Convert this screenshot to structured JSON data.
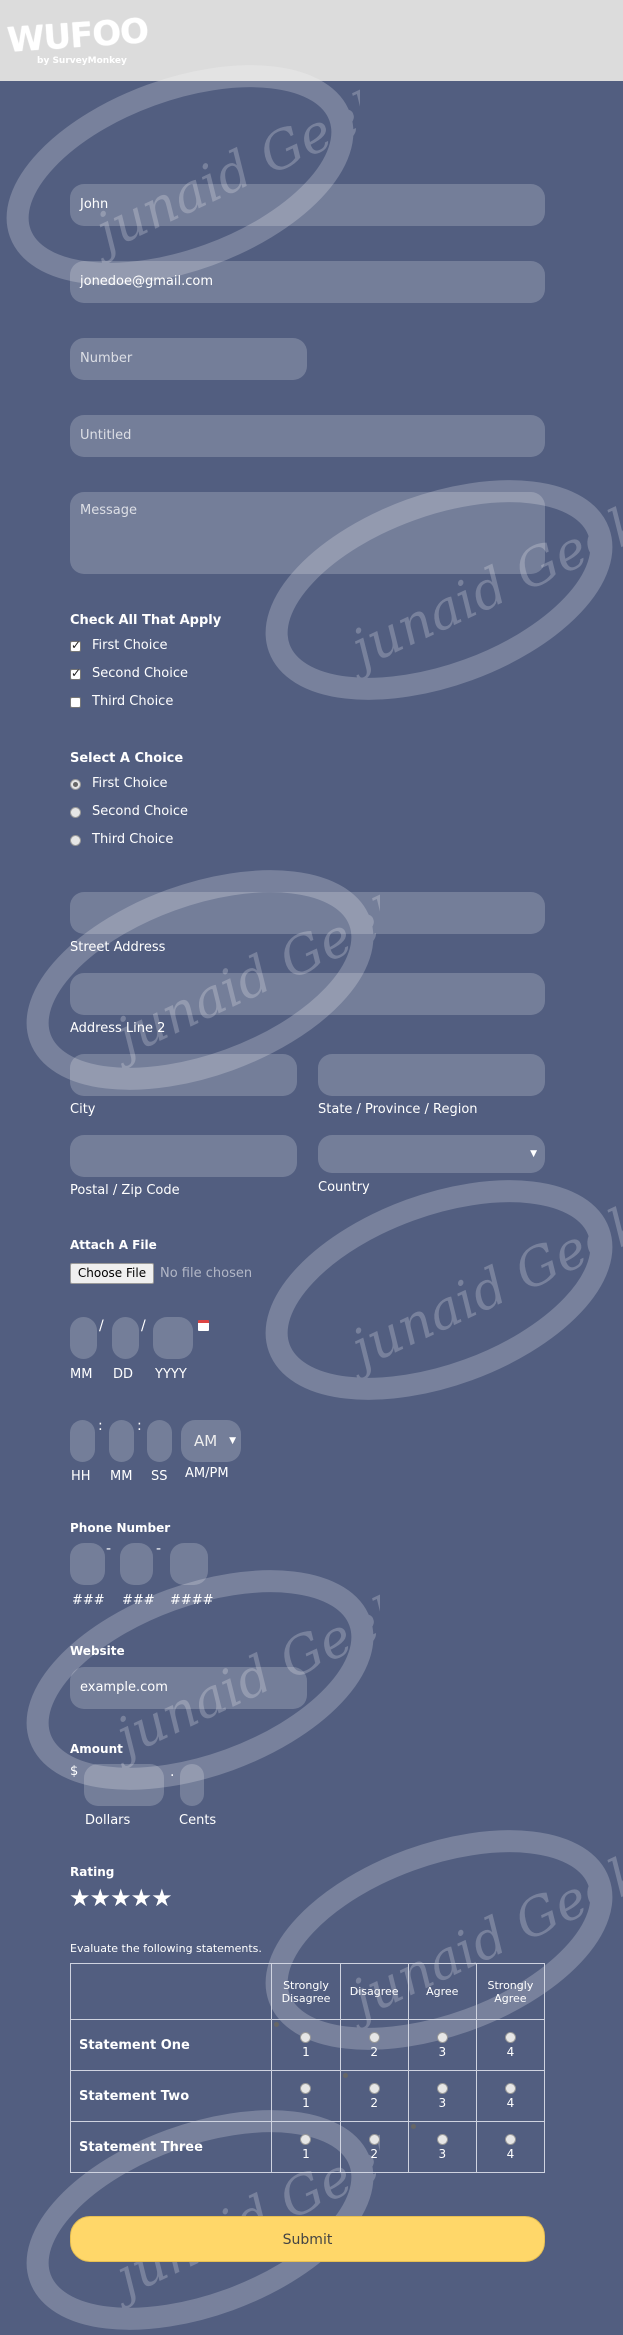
{
  "logo": {
    "word": "WUFOO",
    "sub": "by SurveyMonkey"
  },
  "watermark_text": "junaid Geek",
  "fields": {
    "name_value": "John",
    "email_value": "jonedoe@gmail.com",
    "number_placeholder": "Number",
    "untitled_placeholder": "Untitled",
    "message_placeholder": "Message"
  },
  "checkboxes": {
    "title": "Check All That Apply",
    "items": [
      {
        "label": "First Choice",
        "checked": true
      },
      {
        "label": "Second Choice",
        "checked": true
      },
      {
        "label": "Third Choice",
        "checked": false
      }
    ]
  },
  "radios": {
    "title": "Select A Choice",
    "items": [
      {
        "label": "First Choice",
        "selected": true
      },
      {
        "label": "Second Choice",
        "selected": false
      },
      {
        "label": "Third Choice",
        "selected": false
      }
    ]
  },
  "address": {
    "street": "Street Address",
    "line2": "Address Line 2",
    "city": "City",
    "state": "State / Province / Region",
    "zip": "Postal / Zip Code",
    "country": "Country"
  },
  "file": {
    "title": "Attach A File",
    "button": "Choose File",
    "status": "No file chosen"
  },
  "date": {
    "sep": "/",
    "mm": "MM",
    "dd": "DD",
    "yyyy": "YYYY"
  },
  "time": {
    "sep": ":",
    "hh": "HH",
    "mm": "MM",
    "ss": "SS",
    "ampm_value": "AM",
    "ampm_label": "AM/PM"
  },
  "phone": {
    "title": "Phone Number",
    "sep": "-",
    "p1": "###",
    "p2": "###",
    "p3": "####"
  },
  "website": {
    "title": "Website",
    "value": "example.com"
  },
  "amount": {
    "title": "Amount",
    "currency": "$",
    "sep": ".",
    "dollars": "Dollars",
    "cents": "Cents"
  },
  "rating": {
    "title": "Rating",
    "stars": "★★★★★"
  },
  "matrix": {
    "prompt": "Evaluate the following statements.",
    "columns": [
      "Strongly Disagree",
      "Disagree",
      "Agree",
      "Strongly Agree"
    ],
    "numbers": [
      "1",
      "2",
      "3",
      "4"
    ],
    "rows": [
      {
        "label": "Statement One",
        "selected": 0
      },
      {
        "label": "Statement Two",
        "selected": 1
      },
      {
        "label": "Statement Three",
        "selected": 2
      }
    ]
  },
  "submit_label": "Submit",
  "colors": {
    "background": "#525e80",
    "topbar": "#dcdcdc",
    "submit": "#ffd769"
  }
}
